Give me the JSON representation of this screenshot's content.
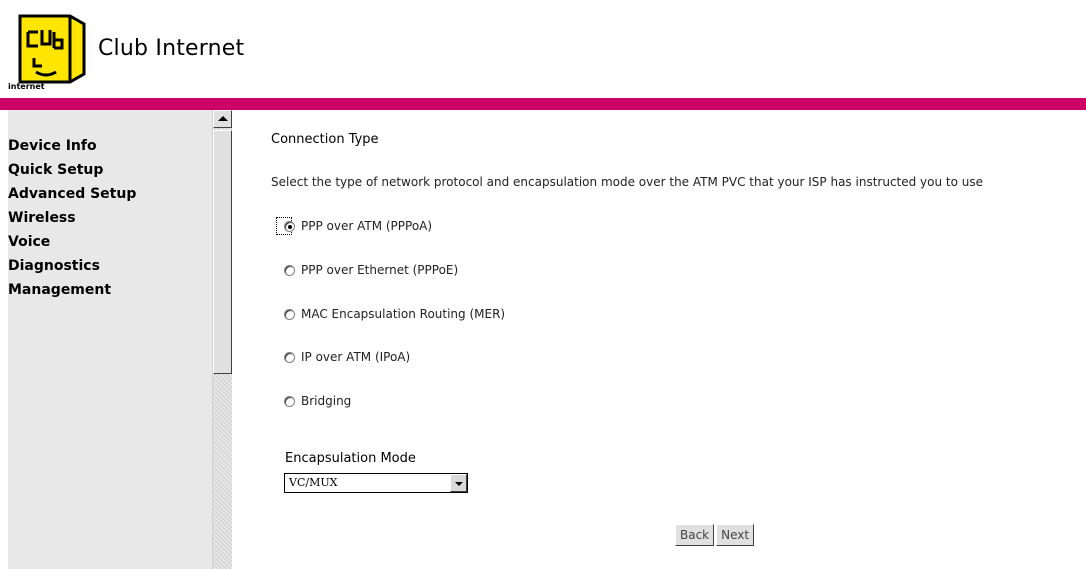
{
  "header": {
    "brand": "Club Internet",
    "logo_text": "internet",
    "bar_color": "#cc0066"
  },
  "sidebar": {
    "items": [
      {
        "label": "Device Info"
      },
      {
        "label": "Quick Setup"
      },
      {
        "label": "Advanced Setup"
      },
      {
        "label": "Wireless"
      },
      {
        "label": "Voice"
      },
      {
        "label": "Diagnostics"
      },
      {
        "label": "Management"
      }
    ]
  },
  "main": {
    "title": "Connection Type",
    "description": "Select the type of network protocol and encapsulation mode over the ATM PVC that your ISP has instructed you to use",
    "options": [
      {
        "label": "PPP over ATM (PPPoA)",
        "checked": true
      },
      {
        "label": "PPP over Ethernet (PPPoE)",
        "checked": false
      },
      {
        "label": "MAC Encapsulation Routing (MER)",
        "checked": false
      },
      {
        "label": "IP over ATM (IPoA)",
        "checked": false
      },
      {
        "label": "Bridging",
        "checked": false
      }
    ],
    "encapsulation_label": "Encapsulation Mode",
    "encapsulation_value": "VC/MUX",
    "back_label": "Back",
    "next_label": "Next"
  }
}
